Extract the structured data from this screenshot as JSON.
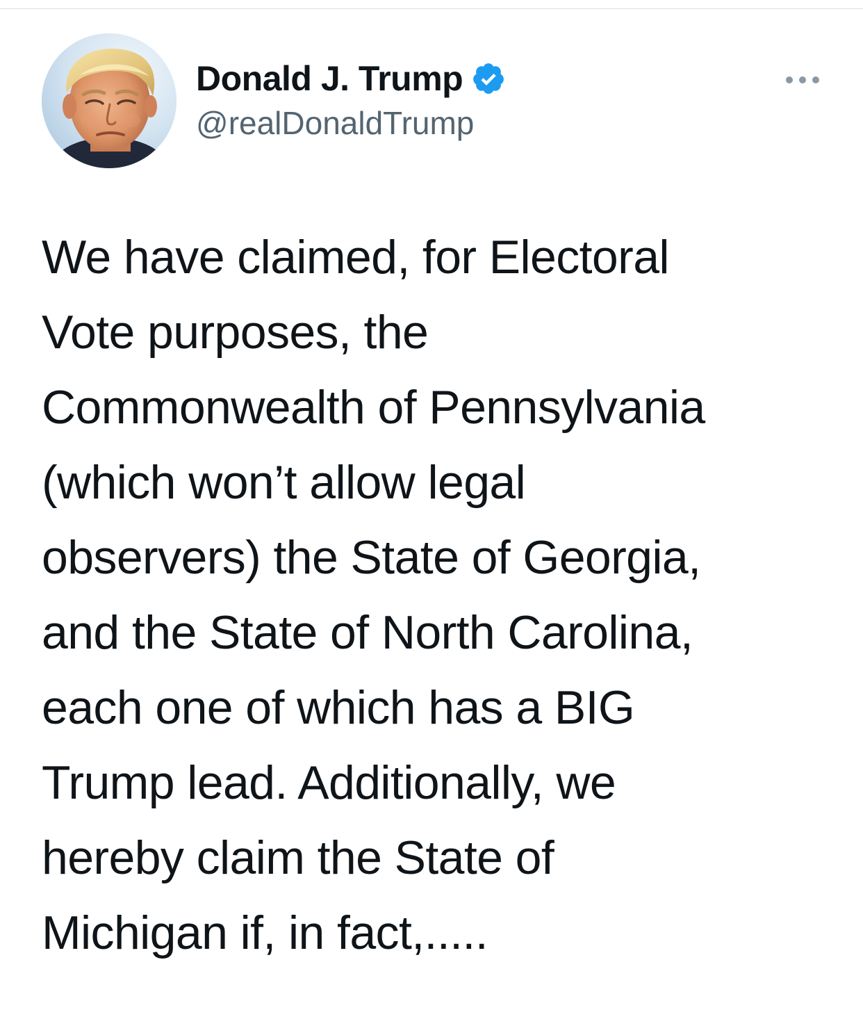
{
  "author": {
    "display_name": "Donald J. Trump",
    "handle": "@realDonaldTrump",
    "verified": true,
    "verified_badge_color": "#1d9bf0"
  },
  "icons": {
    "avatar": "profile-photo",
    "verified": "verified-badge-icon",
    "more": "more-options-icon"
  },
  "colors": {
    "text_primary": "#0f1419",
    "text_secondary": "#536471",
    "divider": "#dcdfe2",
    "background": "#ffffff"
  },
  "tweet": {
    "lines": [
      "We have claimed, for Electoral",
      "Vote purposes, the",
      "Commonwealth of Pennsylvania",
      "(which won’t allow legal",
      "observers) the State of Georgia,",
      "and the State of North Carolina,",
      "each one of which has a BIG",
      "Trump lead. Additionally, we",
      "hereby claim the State of",
      "Michigan if, in fact,....."
    ]
  }
}
